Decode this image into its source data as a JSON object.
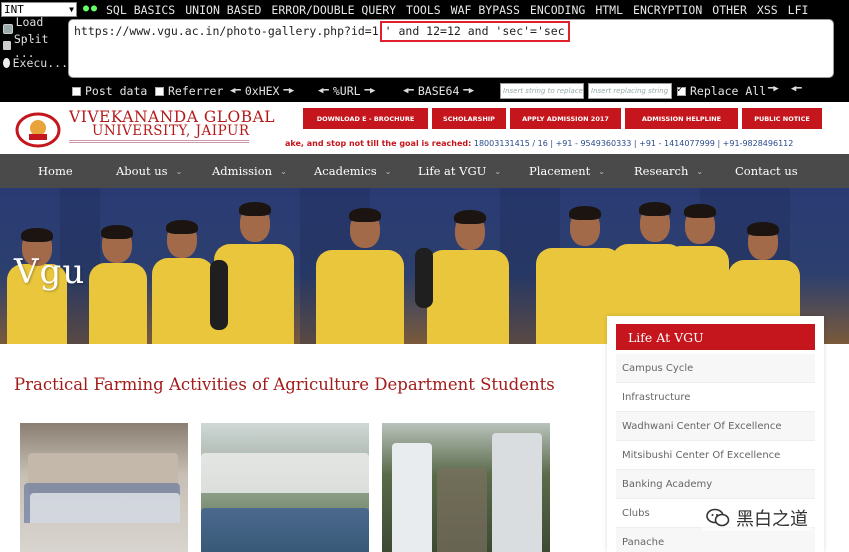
{
  "hackbar": {
    "select_value": "INT",
    "menu": [
      "SQL BASICS",
      "UNION BASED",
      "ERROR/DOUBLE QUERY",
      "TOOLS",
      "WAF BYPASS",
      "ENCODING",
      "HTML",
      "ENCRYPTION",
      "OTHER",
      "XSS",
      "LFI"
    ],
    "side": {
      "load": "Load ...",
      "split": "Split ...",
      "execute": "Execu..."
    },
    "url_base": "https://www.vgu.ac.in/photo-gallery.php?id=1",
    "url_payload": "' and 12=12 and 'sec'='sec",
    "post_data": "Post data",
    "referrer": "Referrer",
    "hex": "0xHEX",
    "url_enc": "%URL",
    "base64": "BASE64",
    "insert_string": "Insert string to replace",
    "insert_replacing": "Insert replacing string",
    "replace_all": "Replace All"
  },
  "site": {
    "logo_line1": "VIVEKANANDA GLOBAL",
    "logo_line2": "UNIVERSITY, JAIPUR",
    "top_buttons": [
      "DOWNLOAD E - BROCHURE",
      "SCHOLARSHIP",
      "APPLY ADMISSION 2017",
      "ADMISSION HELPLINE",
      "PUBLIC NOTICE"
    ],
    "marquee_red": "ake, and stop not till the goal is reached:",
    "marquee_phones": "18003131415 / 16 | +91 - 9549360333 | +91 - 1414077999 | +91-9828496112",
    "nav": [
      "Home",
      "About us",
      "Admission",
      "Academics",
      "Life at VGU",
      "Placement",
      "Research",
      "Contact us"
    ],
    "hero_text": "Vgu",
    "page_title": "Practical Farming Activities of Agriculture Department Students",
    "sidebar_title": "Life At VGU",
    "sidebar_items": [
      "Campus Cycle",
      "Infrastructure",
      "Wadhwani Center Of Excellence",
      "Mitsibushi Center Of Excellence",
      "Banking Academy",
      "Clubs",
      "Panache"
    ],
    "watermark": "黑白之道"
  },
  "colors": {
    "brand_red": "#c4161c",
    "nav_bg": "#4a4a4a",
    "hackbar_bg": "#000000"
  }
}
